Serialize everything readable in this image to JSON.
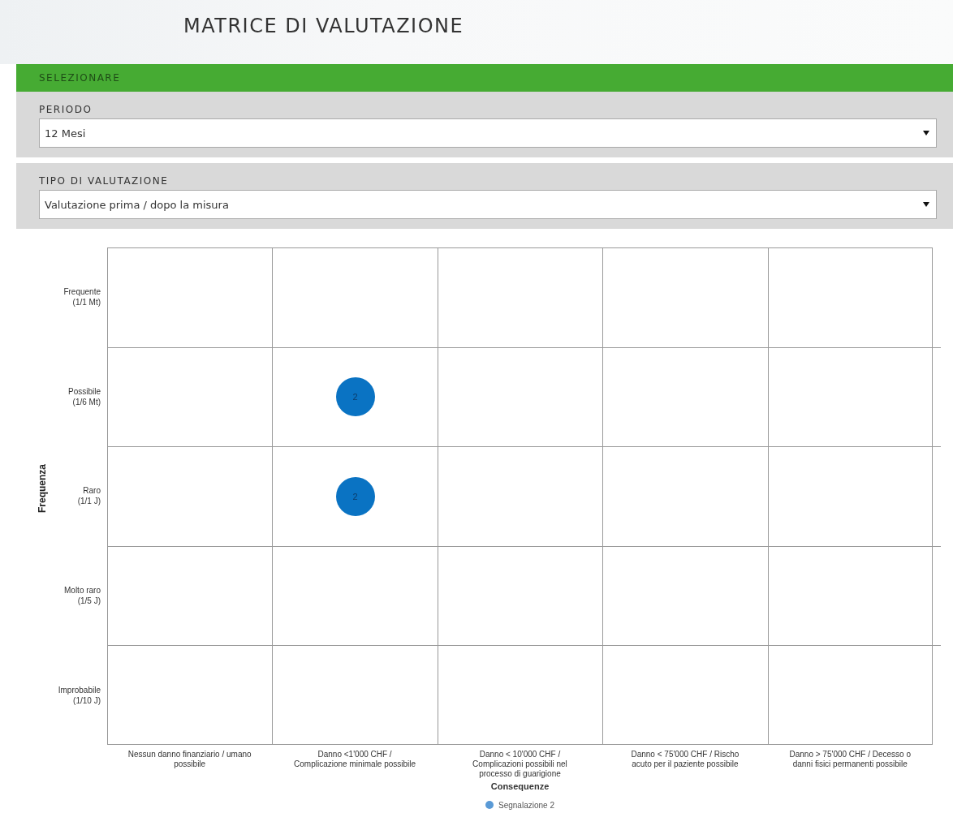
{
  "title": "MATRICE DI VALUTAZIONE",
  "panel": {
    "header": "SELEZIONARE",
    "filters": [
      {
        "label": "PERIODO",
        "value": "12 Mesi"
      },
      {
        "label": "TIPO DI VALUTAZIONE",
        "value": "Valutazione prima / dopo la misura"
      }
    ]
  },
  "matrix": {
    "y_title": "Frequenza",
    "x_title": "Consequenze",
    "frequency_levels": [
      {
        "label": "Frequente",
        "sub": "(1/1 Mt)",
        "cells": [
          {
            "filled": false
          },
          {
            "filled": false
          },
          {
            "filled": false
          },
          {
            "filled": false
          },
          {
            "filled": false
          }
        ]
      },
      {
        "label": "Possibile",
        "sub": "(1/6 Mt)",
        "cells": [
          {
            "filled": false
          },
          {
            "filled": true,
            "label": "2"
          },
          {
            "filled": false
          },
          {
            "filled": false
          },
          {
            "filled": false
          }
        ]
      },
      {
        "label": "Raro",
        "sub": "(1/1 J)",
        "cells": [
          {
            "filled": false
          },
          {
            "filled": true,
            "label": "2"
          },
          {
            "filled": false
          },
          {
            "filled": false
          },
          {
            "filled": false
          }
        ]
      },
      {
        "label": "Molto raro",
        "sub": "(1/5 J)",
        "cells": [
          {
            "filled": false
          },
          {
            "filled": false
          },
          {
            "filled": false
          },
          {
            "filled": false
          },
          {
            "filled": false
          }
        ]
      },
      {
        "label": "Improbabile",
        "sub": "(1/10 J)",
        "cells": [
          {
            "filled": false
          },
          {
            "filled": false
          },
          {
            "filled": false
          },
          {
            "filled": false
          },
          {
            "filled": false
          }
        ]
      }
    ],
    "columns": [
      "Nessun danno finanziario / umano possibile",
      "Danno <1'000 CHF / Complicazione minimale possibile",
      "Danno < 10'000 CHF / Complicazioni possibili nel processo di guarigione",
      "Danno < 75'000 CHF / Rischo acuto per il paziente possibile",
      "Danno > 75'000 CHF / Decesso o danni fisici permanenti possibile"
    ],
    "legend": [
      {
        "label": "Segnalazione 2"
      }
    ]
  }
}
